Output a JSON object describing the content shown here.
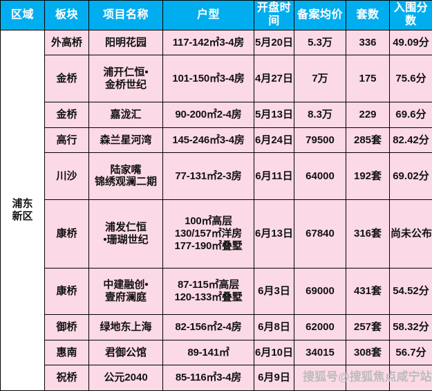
{
  "table": {
    "headers": [
      {
        "key": "region",
        "label": "区域"
      },
      {
        "key": "block",
        "label": "板块"
      },
      {
        "key": "name",
        "label": "项目名称"
      },
      {
        "key": "layout",
        "label": "户型"
      },
      {
        "key": "date",
        "label": "开盘时间"
      },
      {
        "key": "price",
        "label": "备案均价"
      },
      {
        "key": "units",
        "label": "套数"
      },
      {
        "key": "score",
        "label": "入围分数"
      }
    ],
    "region_label": "浦东新区",
    "rows": [
      {
        "block": "外高桥",
        "name": "阳明花园",
        "layout": [
          "117-142㎡3-4房"
        ],
        "date": "5月20日",
        "price": "5.3万",
        "units": "336",
        "score": "49.09分"
      },
      {
        "block": "金桥",
        "name": [
          "浦开仁恒•",
          "金桥世纪"
        ],
        "layout": [
          "101-150㎡3-4房"
        ],
        "date": "4月27日",
        "price": "7万",
        "units": "175",
        "score": "75.6分"
      },
      {
        "block": "金桥",
        "name": "嘉泷汇",
        "layout": [
          "90-200㎡2-4房"
        ],
        "date": "5月13日",
        "price": "8.3万",
        "units": "229",
        "score": "69.6分"
      },
      {
        "block": "高行",
        "name": "森兰星河湾",
        "layout": [
          "145-246㎡3-4房"
        ],
        "date": "6月24日",
        "price": "79500",
        "units": "285套",
        "score": "82.42分"
      },
      {
        "block": "川沙",
        "name": [
          "陆家嘴",
          "锦绣观澜二期"
        ],
        "layout": [
          "77-131㎡2-3房"
        ],
        "date": "6月11日",
        "price": "64000",
        "units": "192套",
        "score": "69.02分"
      },
      {
        "block": "康桥",
        "name": [
          "浦发仁恒",
          "•珊瑚世纪"
        ],
        "layout": [
          "100㎡高层",
          "130/157㎡洋房",
          "177-190㎡叠墅"
        ],
        "date": "6月13日",
        "price": "67840",
        "units": "316套",
        "score": "尚未公布"
      },
      {
        "block": "康桥",
        "name": [
          "中建融创•",
          "壹府澜庭"
        ],
        "layout": [
          "87-115㎡高层",
          "120-133㎡叠墅"
        ],
        "date": "6月3日",
        "price": "69000",
        "units": "431套",
        "score": "54.52分"
      },
      {
        "block": "御桥",
        "name": "绿地东上海",
        "layout": [
          "82-156㎡2-4房"
        ],
        "date": "6月8日",
        "price": "62000",
        "units": "257套",
        "score": "58.32分"
      },
      {
        "block": "惠南",
        "name": "君御公馆",
        "layout": [
          "89-141㎡"
        ],
        "date": "6月10日",
        "price": "34015",
        "units": "308套",
        "score": "56.7分"
      },
      {
        "block": "祝桥",
        "name": "公元2040",
        "layout": [
          "85-116㎡3-4房"
        ],
        "date": "6月9日",
        "price": "",
        "units": "",
        "score": ""
      }
    ]
  },
  "watermark": {
    "text": "搜狐号@搜狐焦点咸宁站"
  },
  "colors": {
    "header_bg": "#00AEEF",
    "header_fg": "#FFFFFF",
    "cell_bg": "#FBD9E6",
    "region_bg": "#FFFFFF",
    "border": "#000000",
    "text": "#111111"
  }
}
